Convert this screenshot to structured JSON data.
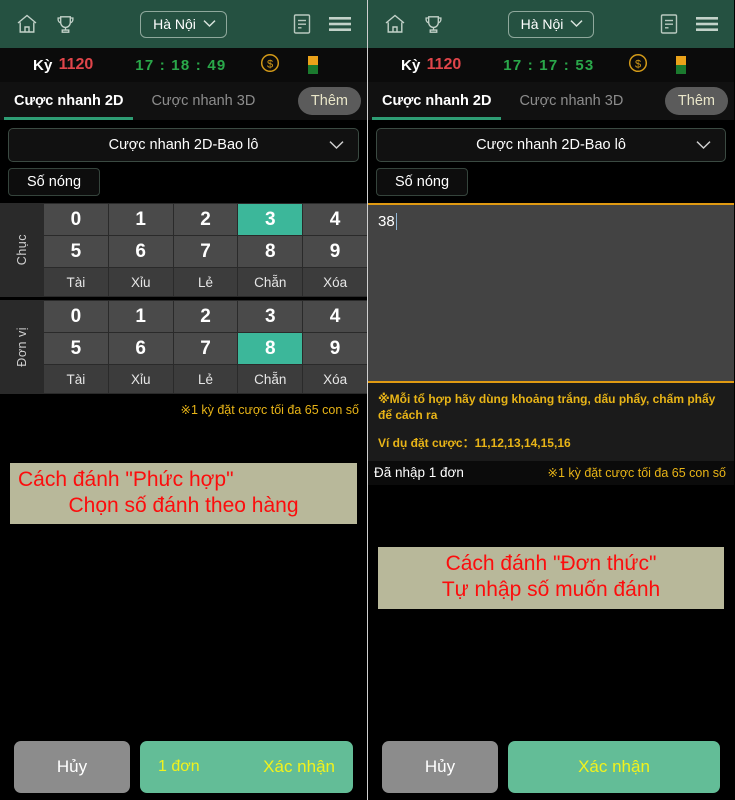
{
  "header": {
    "home_icon": "home-icon",
    "trophy_icon": "trophy-icon",
    "region_label": "Hà Nội",
    "chevron_icon": "chevron-down-icon",
    "record_icon": "document-list-icon",
    "menu_icon": "hamburger-menu-icon",
    "bg_color": "#255141"
  },
  "left": {
    "status": {
      "period_label": "Kỳ",
      "period_number": "1120",
      "clock": "17 : 18 : 49",
      "coin_icon": "coin-dollar-icon",
      "flag_icon": "flag-icon"
    },
    "tabs": [
      {
        "label": "Cược nhanh 2D",
        "active": true
      },
      {
        "label": "Cược nhanh 3D",
        "active": false
      }
    ],
    "more_label": "Thêm",
    "bet_type": "Cược nhanh 2D-Bao lô",
    "hot_number_label": "Số nóng",
    "groups": [
      {
        "label": "Chục",
        "row1": [
          "0",
          "1",
          "2",
          "3",
          "4"
        ],
        "row2": [
          "5",
          "6",
          "7",
          "8",
          "9"
        ],
        "selected": [
          "3"
        ],
        "ops": [
          "Tài",
          "Xỉu",
          "Lẻ",
          "Chẵn",
          "Xóa"
        ]
      },
      {
        "label": "Đơn vị",
        "row1": [
          "0",
          "1",
          "2",
          "3",
          "4"
        ],
        "row2": [
          "5",
          "6",
          "7",
          "8",
          "9"
        ],
        "selected": [
          "8"
        ],
        "ops": [
          "Tài",
          "Xỉu",
          "Lẻ",
          "Chẵn",
          "Xóa"
        ]
      }
    ],
    "max_warning": "※1 kỳ đặt cược tối đa 65 con số",
    "annotation": {
      "line1": "Cách đánh \"Phức hợp\"",
      "line2": "Chọn số đánh theo hàng"
    },
    "footer": {
      "cancel_label": "Hủy",
      "count_label": "1 đơn",
      "confirm_label": "Xác nhận"
    }
  },
  "right": {
    "status": {
      "period_label": "Kỳ",
      "period_number": "1120",
      "clock": "17 : 17 : 53",
      "coin_icon": "coin-dollar-icon",
      "flag_icon": "flag-icon"
    },
    "tabs": [
      {
        "label": "Cược nhanh 2D",
        "active": true
      },
      {
        "label": "Cược nhanh 3D",
        "active": false
      }
    ],
    "more_label": "Thêm",
    "bet_type": "Cược nhanh 2D-Bao lô",
    "hot_number_label": "Số nóng",
    "input_value": "38",
    "input_placeholder": "",
    "hint_separator": "※Mỗi tổ hợp hãy dùng khoảng trắng, dấu phẩy, chấm phẩy để cách ra",
    "hint_example": "Ví dụ đặt cược：11,12,13,14,15,16",
    "entered_label": "Đã nhập 1 đơn",
    "max_warning": "※1 kỳ đặt cược tối đa 65 con số",
    "annotation": {
      "line1": "Cách đánh \"Đơn thức\"",
      "line2": "Tự nhập số muốn đánh"
    },
    "footer": {
      "cancel_label": "Hủy",
      "confirm_label": "Xác nhận"
    }
  },
  "colors": {
    "header_green": "#255141",
    "selected_teal": "#3cb79a",
    "accent_yellow": "#e8b417",
    "annotation_red": "#fc0d0d",
    "annotation_bg": "#b8b89a",
    "confirm_green": "#63bd97",
    "orange_border": "#e09a12"
  }
}
